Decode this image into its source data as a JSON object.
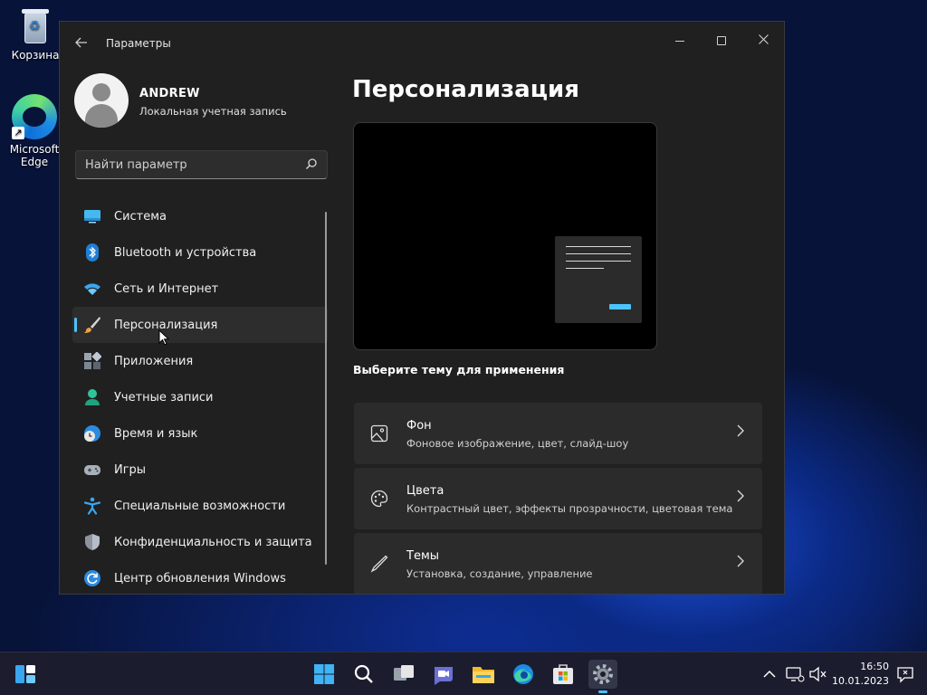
{
  "desktop": {
    "recycle_bin_label": "Корзина",
    "edge_label": "Microsoft Edge"
  },
  "window": {
    "title": "Параметры"
  },
  "profile": {
    "name": "ANDREW",
    "account_type": "Локальная учетная запись"
  },
  "search": {
    "placeholder": "Найти параметр"
  },
  "nav": {
    "items": [
      {
        "label": "Система",
        "icon": "display-icon"
      },
      {
        "label": "Bluetooth и устройства",
        "icon": "bluetooth-icon"
      },
      {
        "label": "Сеть и Интернет",
        "icon": "wifi-icon"
      },
      {
        "label": "Персонализация",
        "icon": "brush-icon",
        "selected": true
      },
      {
        "label": "Приложения",
        "icon": "apps-icon"
      },
      {
        "label": "Учетные записи",
        "icon": "person-icon"
      },
      {
        "label": "Время и язык",
        "icon": "globe-clock-icon"
      },
      {
        "label": "Игры",
        "icon": "gamepad-icon"
      },
      {
        "label": "Специальные возможности",
        "icon": "accessibility-icon"
      },
      {
        "label": "Конфиденциальность и защита",
        "icon": "shield-icon"
      },
      {
        "label": "Центр обновления Windows",
        "icon": "update-icon"
      }
    ]
  },
  "main": {
    "title": "Персонализация",
    "theme_prompt": "Выберите тему для применения",
    "cards": [
      {
        "title": "Фон",
        "subtitle": "Фоновое изображение, цвет, слайд-шоу",
        "icon": "image-icon"
      },
      {
        "title": "Цвета",
        "subtitle": "Контрастный цвет, эффекты прозрачности, цветовая тема",
        "icon": "palette-icon"
      },
      {
        "title": "Темы",
        "subtitle": "Установка, создание, управление",
        "icon": "pen-icon"
      }
    ]
  },
  "taskbar": {
    "time": "16:50",
    "date": "10.01.2023",
    "apps": [
      "widgets",
      "start",
      "search",
      "task-view",
      "chat",
      "file-explorer",
      "edge",
      "store",
      "settings"
    ]
  },
  "colors": {
    "accent": "#4cc2ff",
    "window_bg": "#202020",
    "card_bg": "#2b2b2b"
  }
}
